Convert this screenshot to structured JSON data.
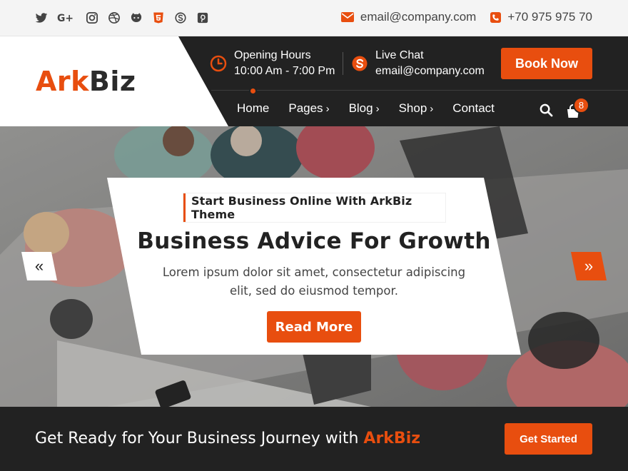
{
  "topbar": {
    "social_icons": [
      "twitter-icon",
      "google-plus-icon",
      "instagram-icon",
      "dribbble-icon",
      "github-icon",
      "html5-icon",
      "skype-icon",
      "pinterest-icon"
    ],
    "email": "email@company.com",
    "phone": "+70 975 975 70"
  },
  "header": {
    "logo_part1": "Ark",
    "logo_part2": "Biz",
    "hours_label": "Opening Hours",
    "hours_value": "10:00 Am - 7:00 Pm",
    "chat_label": "Live Chat",
    "chat_value": "email@company.com",
    "book_label": "Book Now",
    "cart_count": "8"
  },
  "nav": {
    "items": [
      {
        "label": "Home",
        "chevron": ""
      },
      {
        "label": "Pages",
        "chevron": "›"
      },
      {
        "label": "Blog",
        "chevron": "›"
      },
      {
        "label": "Shop",
        "chevron": "›"
      },
      {
        "label": "Contact",
        "chevron": ""
      }
    ]
  },
  "hero": {
    "tagline": "Start Business Online With ArkBiz Theme",
    "title": "Business Advice For Growth",
    "desc_line1": "Lorem ipsum dolor sit amet, consectetur adipiscing",
    "desc_line2": "elit, sed do eiusmod tempor.",
    "button": "Read More",
    "prev_arrow": "«",
    "next_arrow": "»"
  },
  "cta": {
    "text": "Get Ready for Your Business Journey with ",
    "brand": "ArkBiz",
    "button": "Get Started"
  },
  "colors": {
    "accent": "#e84e0f",
    "dark": "#222222",
    "topbar_bg": "#f4f4f4"
  }
}
